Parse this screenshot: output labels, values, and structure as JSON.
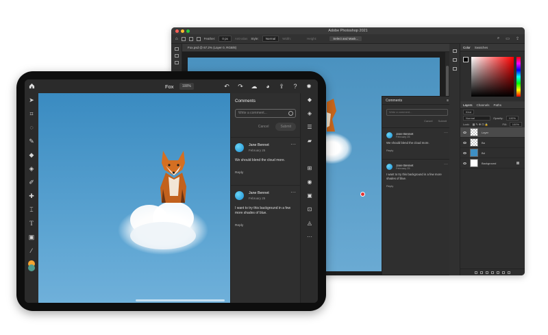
{
  "desktop": {
    "window_title": "Adobe Photoshop 2021",
    "options": {
      "feather_label": "Feather:",
      "feather_value": "0 px",
      "antialias_label": "Anti-alias",
      "style_label": "Style:",
      "style_value": "Normal",
      "width_label": "Width:",
      "height_label": "Height:",
      "select_mask_label": "Select and Mask..."
    },
    "doc_tab": "Fox.psd @ 67.2% (Layer 0, RGB/8)",
    "comments": {
      "title": "Comments",
      "placeholder": "Write a comment...",
      "cancel": "Cancel",
      "submit": "Submit",
      "items": [
        {
          "name": "Jane Bennet",
          "date": "February 25",
          "text": "We should blend the cloud more.",
          "reply": "Reply"
        },
        {
          "name": "Jane Bennet",
          "date": "February 25",
          "text": "I want to try this background in a few more shades of blue.",
          "reply": "Reply"
        }
      ]
    },
    "panels": {
      "color_tabs": [
        "Color",
        "Swatches"
      ],
      "layers_tabs": [
        "Layers",
        "Channels",
        "Paths"
      ],
      "kind_label": "Kind",
      "blend_mode": "Normal",
      "opacity_label": "Opacity:",
      "opacity_value": "100%",
      "lock_label": "Lock:",
      "fill_label": "Fill:",
      "fill_value": "100%",
      "layers": [
        {
          "name": "Layer",
          "thumb": "checker",
          "selected": true
        },
        {
          "name": "Ba",
          "thumb": "checker",
          "selected": false
        },
        {
          "name": "Bd",
          "thumb": "blue",
          "selected": false
        },
        {
          "name": "Background",
          "thumb": "white",
          "selected": false
        }
      ]
    }
  },
  "ipad": {
    "doc_title": "Fox",
    "zoom": "100%",
    "comments": {
      "title": "Comments",
      "placeholder": "Write a comment...",
      "cancel": "Cancel",
      "submit": "Submit",
      "items": [
        {
          "name": "Jane Bennet",
          "date": "February 25",
          "text": "We should blend the cloud more.",
          "reply": "Reply"
        },
        {
          "name": "Jane Bennet",
          "date": "February 25",
          "text": "I want to try this background in a few more shades of blue.",
          "reply": "Reply"
        }
      ]
    },
    "left_tools": [
      "select-icon",
      "lasso-icon",
      "quick-select-icon",
      "brush-icon",
      "eraser-icon",
      "fill-icon",
      "smudge-icon",
      "healing-icon",
      "crop-icon",
      "type-icon",
      "image-icon",
      "eyedropper-icon"
    ],
    "right_tools": [
      "layers-icon",
      "adjustment-icon",
      "properties-icon",
      "comments-icon",
      "add-layer-icon",
      "visibility-icon",
      "mask-icon",
      "clip-icon",
      "fill-layer-icon",
      "more-icon"
    ],
    "colors": {
      "primary": "#f5a431",
      "secondary": "#4f9b8f"
    }
  }
}
